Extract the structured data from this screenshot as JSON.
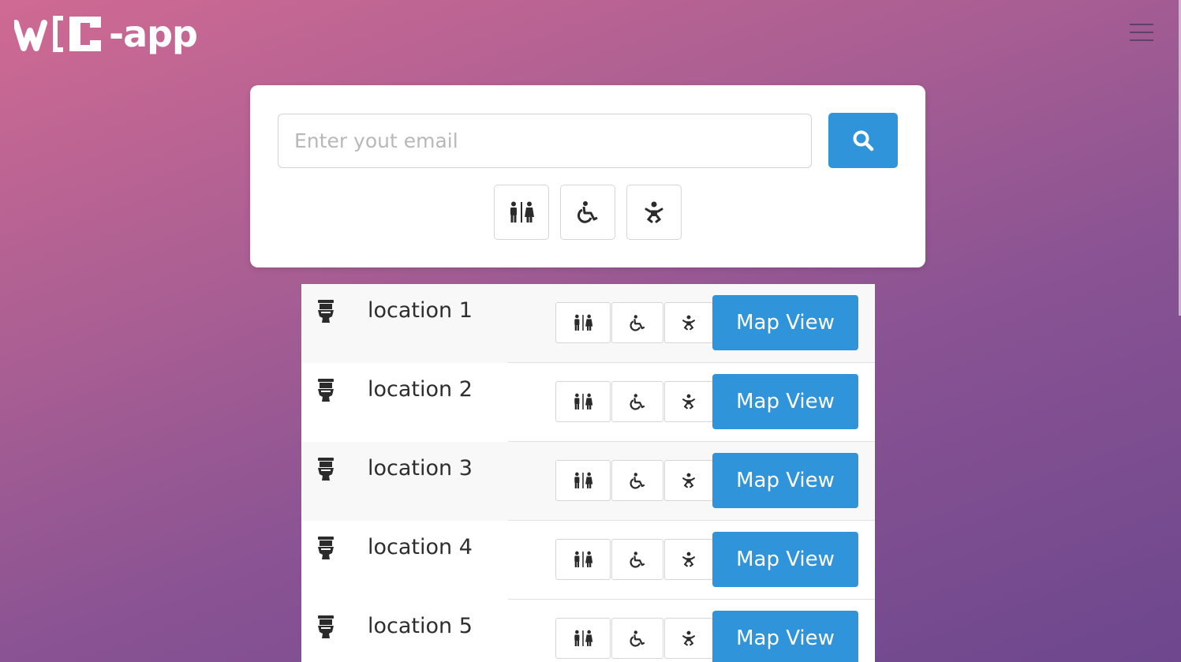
{
  "header": {
    "logo_text": "-app",
    "logo_mark": "WC",
    "menu_icon": "hamburger-menu-icon"
  },
  "search": {
    "placeholder": "Enter yout email",
    "button_icon": "search-icon"
  },
  "filters": [
    {
      "icon": "restroom-icon"
    },
    {
      "icon": "wheelchair-icon"
    },
    {
      "icon": "baby-icon"
    }
  ],
  "locations": [
    {
      "label": "location 1",
      "button": "Map View"
    },
    {
      "label": "location 2",
      "button": "Map View"
    },
    {
      "label": "location 3",
      "button": "Map View"
    },
    {
      "label": "location 4",
      "button": "Map View"
    },
    {
      "label": "location 5",
      "button": "Map View"
    }
  ],
  "colors": {
    "accent": "#2f94d9",
    "icon": "#2b2b2b",
    "gradient_start": "#cf6a93",
    "gradient_end": "#6d478d"
  }
}
